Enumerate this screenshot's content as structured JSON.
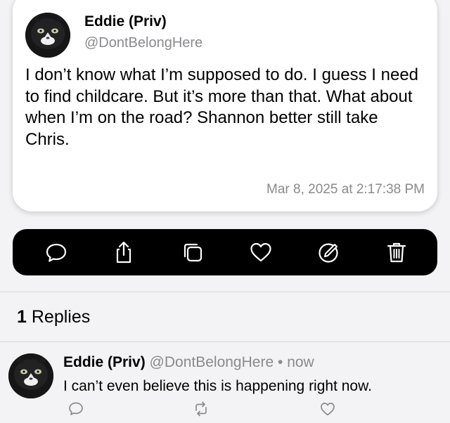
{
  "post": {
    "author_name": "Eddie (Priv)",
    "author_handle": "@DontBelongHere",
    "text": "I don’t know what I’m supposed to do. I guess I need to find childcare. But it’s more than that. What about when I’m on the road? Shannon better still take Chris.",
    "timestamp": "Mar 8, 2025 at 2:17:38 PM"
  },
  "toolbar": {
    "actions": [
      "reply-icon",
      "share-icon",
      "copy-icon",
      "like-icon",
      "edit-icon",
      "delete-icon"
    ]
  },
  "replies_section": {
    "count": "1",
    "label": "Replies"
  },
  "reply": {
    "author_name": "Eddie (Priv)",
    "author_handle": "@DontBelongHere",
    "separator": "•",
    "time": "now",
    "text": "I can’t even believe this is happening right now.",
    "actions": [
      "reply-icon",
      "repost-icon",
      "like-icon"
    ]
  },
  "colors": {
    "background": "#f3f3f5",
    "card": "#ffffff",
    "toolbar": "#000000",
    "secondary_text": "#8a8a8e"
  }
}
